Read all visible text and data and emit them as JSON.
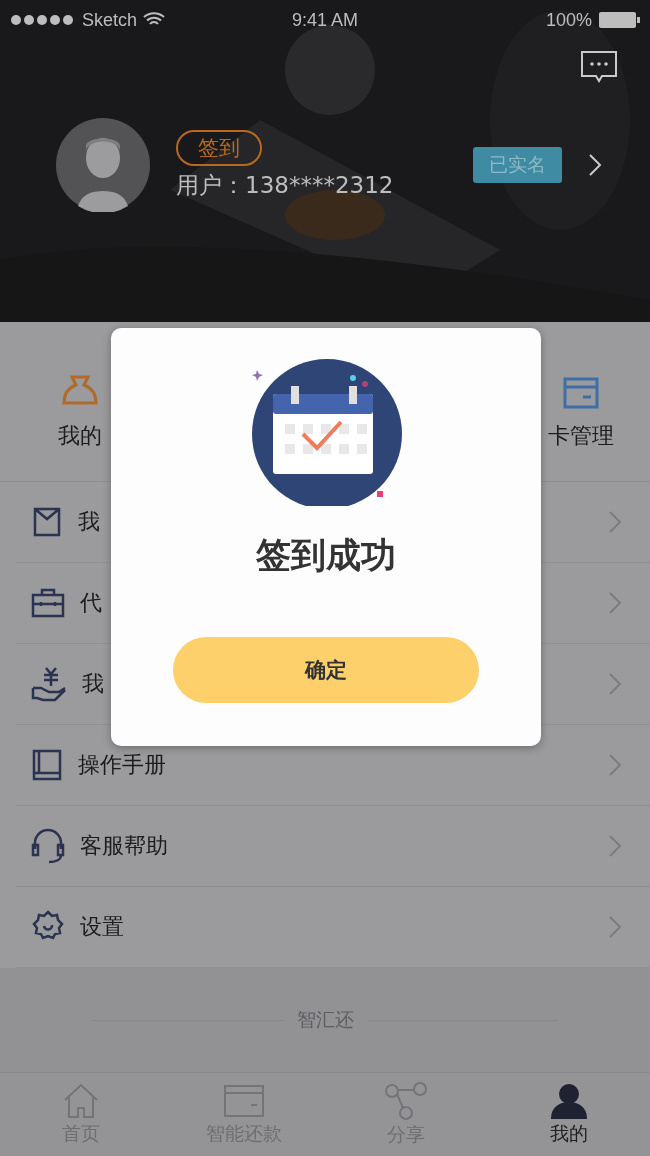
{
  "status_bar": {
    "carrier": "Sketch",
    "time": "9:41 AM",
    "battery": "100%"
  },
  "header": {
    "checkin_button": "签到",
    "user": "用户：138****2312",
    "verified_badge": "已实名"
  },
  "quick_links": [
    {
      "label": "我的"
    },
    {
      "label": "卡管理"
    }
  ],
  "menu": [
    {
      "label": "我"
    },
    {
      "label": "代"
    },
    {
      "label": "我"
    },
    {
      "label": "操作手册"
    },
    {
      "label": "客服帮助"
    },
    {
      "label": "设置"
    }
  ],
  "footer": {
    "brand": "智汇还"
  },
  "tabs": [
    {
      "label": "首页",
      "selected": false
    },
    {
      "label": "智能还款",
      "selected": false
    },
    {
      "label": "分享",
      "selected": false
    },
    {
      "label": "我的",
      "selected": true
    }
  ],
  "dialog": {
    "title": "签到成功",
    "confirm": "确定"
  }
}
